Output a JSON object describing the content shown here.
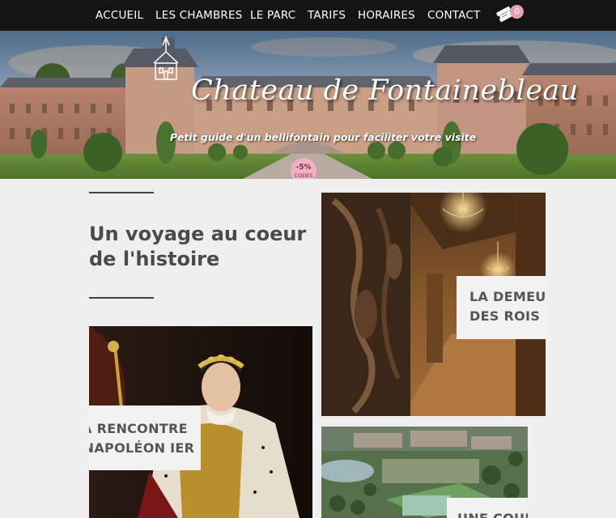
{
  "nav": {
    "items": [
      "ACCUEIL",
      "LES CHAMBRES",
      "LE PARC",
      "TARIFS",
      "HORAIRES",
      "CONTACT"
    ],
    "cart_icon": "ticket-icon",
    "cart_count": "0"
  },
  "hero": {
    "title": "Chateau de Fontainebleau",
    "subtitle": "Petit guide d'un bellifontain pour faciliter votre visite",
    "promo_percent": "-5%",
    "promo_label": "CODES"
  },
  "intro": {
    "heading_line1": "Un voyage au coeur",
    "heading_line2": "de l'histoire"
  },
  "cards": [
    {
      "line1": "LA DEMEURE",
      "line2": "DES ROIS"
    },
    {
      "line1": "À LA RENCONTRE",
      "line2": "DE NAPOLÉON IER"
    },
    {
      "line1": "UNE COURSE"
    }
  ],
  "colors": {
    "nav_bg": "#141414",
    "page_bg": "#efefef",
    "badge": "#e8a0b5",
    "promo": "#efb2c4",
    "text": "#4a4a4a"
  }
}
